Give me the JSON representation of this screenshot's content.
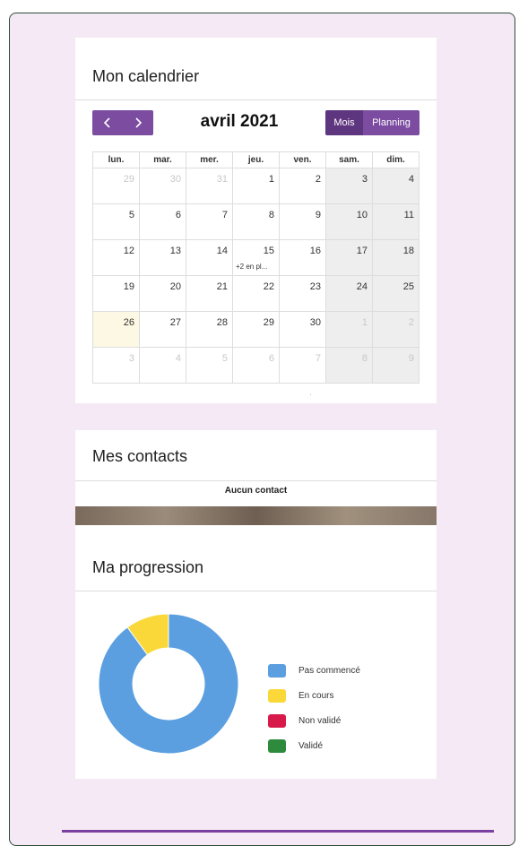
{
  "calendar": {
    "title": "Mon calendrier",
    "prev_icon": "chevron-left-icon",
    "next_icon": "chevron-right-icon",
    "month": "avril 2021",
    "views": [
      "Mois",
      "Planning"
    ],
    "weekdays": [
      "lun.",
      "mar.",
      "mer.",
      "jeu.",
      "ven.",
      "sam.",
      "dim."
    ],
    "weeks": [
      [
        "29",
        "30",
        "31",
        "1",
        "2",
        "3",
        "4"
      ],
      [
        "5",
        "6",
        "7",
        "8",
        "9",
        "10",
        "11"
      ],
      [
        "12",
        "13",
        "14",
        "15",
        "16",
        "17",
        "18"
      ],
      [
        "19",
        "20",
        "21",
        "22",
        "23",
        "24",
        "25"
      ],
      [
        "26",
        "27",
        "28",
        "29",
        "30",
        "1",
        "2"
      ],
      [
        "3",
        "4",
        "5",
        "6",
        "7",
        "8",
        "9"
      ]
    ],
    "more_events_label": "+2 en pl..."
  },
  "contacts": {
    "title": "Mes contacts",
    "empty_label": "Aucun contact"
  },
  "progress": {
    "title": "Ma progression",
    "legend": [
      {
        "label": "Pas commencé",
        "color": "#5b9fe0"
      },
      {
        "label": "En cours",
        "color": "#fbd83a"
      },
      {
        "label": "Non validé",
        "color": "#d81a4a"
      },
      {
        "label": "Validé",
        "color": "#2e8b3e"
      }
    ]
  },
  "chart_data": {
    "type": "pie",
    "categories": [
      "Pas commencé",
      "En cours",
      "Non validé",
      "Validé"
    ],
    "values": [
      90,
      10,
      0,
      0
    ],
    "colors": [
      "#5b9fe0",
      "#fbd83a",
      "#d81a4a",
      "#2e8b3e"
    ],
    "legend": "right"
  }
}
